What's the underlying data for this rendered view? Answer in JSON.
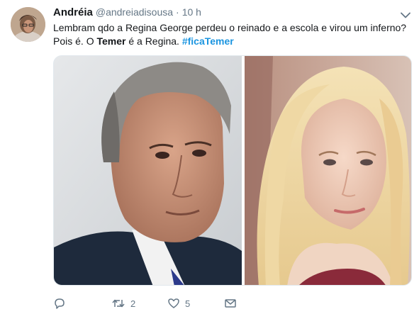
{
  "author": {
    "display_name": "Andréia",
    "handle": "@andreiadisousa",
    "separator": "·",
    "timestamp": "10 h"
  },
  "tweet": {
    "line1": "Lembram qdo a Regina George perdeu o reinado e a escola e virou um inferno?",
    "line2_prefix": "Pois é. O ",
    "line2_bold": "Temer",
    "line2_suffix": " é a Regina. ",
    "hashtag": "#ficaTemer"
  },
  "media": {
    "left_photo": "older-man-portrait",
    "right_photo": "blonde-woman-portrait"
  },
  "actions": {
    "reply_count": "",
    "retweet_count": "2",
    "like_count": "5"
  },
  "colors": {
    "text": "#14171a",
    "secondary": "#657786",
    "link": "#1b95e0"
  }
}
